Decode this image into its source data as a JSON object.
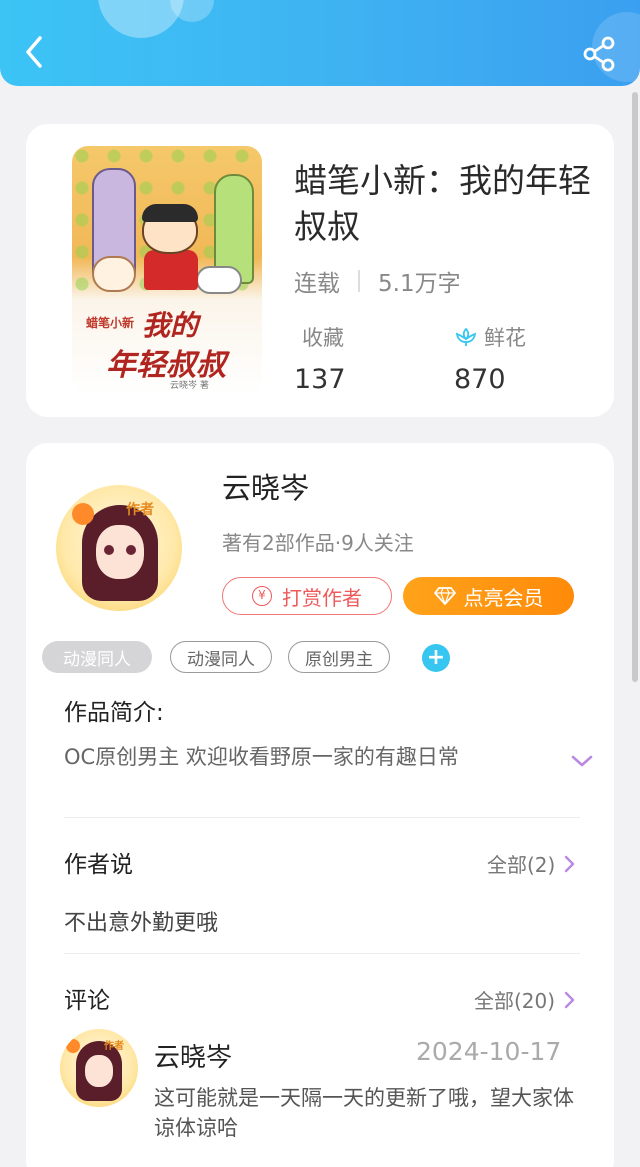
{
  "header": {
    "back_icon": "chevron-left-icon",
    "share_icon": "share-icon",
    "gradient_from": "#3cc4f5",
    "gradient_to": "#3a9ff0"
  },
  "book": {
    "cover": {
      "series_text": "蜡笔小新",
      "title_line1": "我的",
      "title_line2": "年轻叔叔",
      "author_text": "云晓岑 著"
    },
    "title": "蜡笔小新：我的年轻叔叔",
    "status": "连载",
    "word_count": "5.1万字",
    "favorites_label": "收藏",
    "favorites_value": "137",
    "flowers_label": "鲜花",
    "flowers_value": "870",
    "flower_icon": "flower-icon"
  },
  "author": {
    "name": "云晓岑",
    "avatar_badge": "作者",
    "meta": "著有2部作品·9人关注",
    "tip_button": "打赏作者",
    "tip_icon": "yen-icon",
    "vip_button": "点亮会员",
    "vip_icon": "diamond-icon",
    "tags": [
      "动漫同人",
      "动漫同人",
      "原创男主"
    ],
    "add_tag": "+"
  },
  "intro": {
    "title": "作品简介:",
    "text": "OC原创男主 欢迎收看野原一家的有趣日常"
  },
  "author_say": {
    "title": "作者说",
    "see_all": "全部(2)",
    "text": "不出意外勤更哦"
  },
  "comments": {
    "title": "评论",
    "see_all": "全部(20)",
    "items": [
      {
        "user": "云晓岑",
        "avatar_badge": "作者",
        "date": "2024-10-17",
        "text": "这可能就是一天隔一天的更新了哦，望大家体谅体谅哈"
      }
    ]
  },
  "colors": {
    "accent_blue": "#36c6f0",
    "tip_red": "#ee5a5a",
    "vip_orange": "#ff9512",
    "chevron_purple": "#b98ae0"
  }
}
